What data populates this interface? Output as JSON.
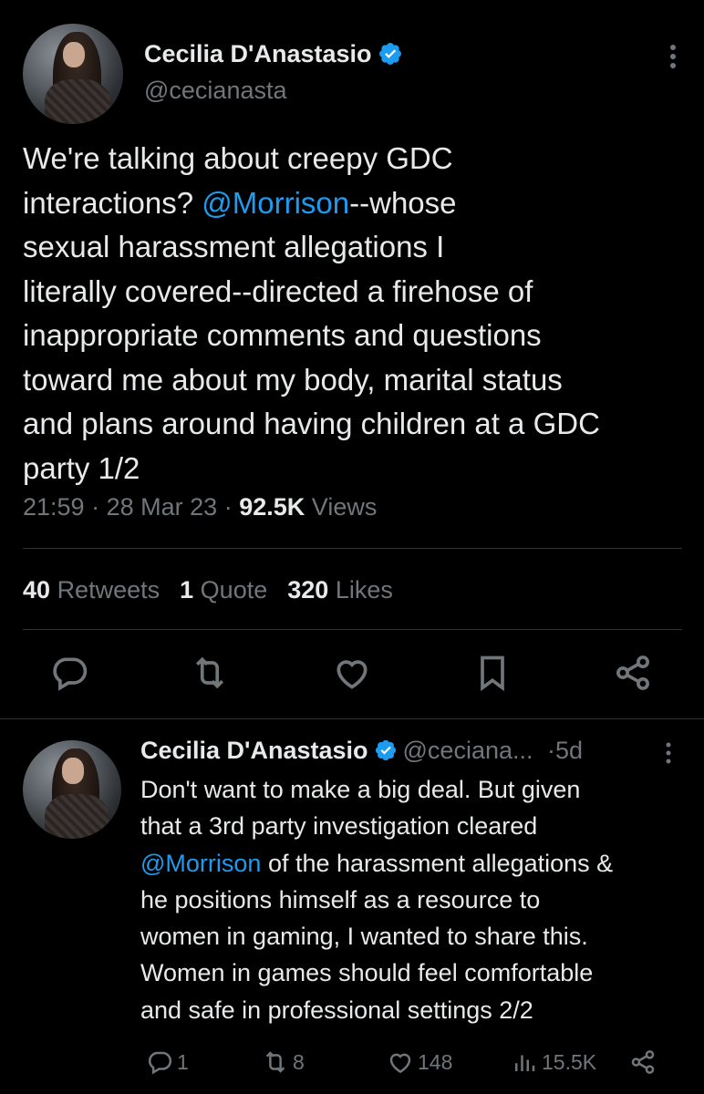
{
  "main_tweet": {
    "author_name": "Cecilia D'Anastasio",
    "author_handle": "@cecianasta",
    "text_part1": "We're talking about creepy GDC\ninteractions? ",
    "mention": "@Morrison",
    "text_part2": "--whose\nsexual harassment allegations I\nliterally covered--directed a firehose of\ninappropriate comments and questions\ntoward me about my body, marital status\nand plans around having children at a GDC\nparty 1/2",
    "time": "21:59",
    "date": "28 Mar 23",
    "views_count": "92.5K",
    "views_label": "Views",
    "separator": "·",
    "retweets_count": "40",
    "retweets_label": "Retweets",
    "quotes_count": "1",
    "quotes_label": "Quote",
    "likes_count": "320",
    "likes_label": "Likes",
    "icons": [
      "more-icon",
      "reply-icon",
      "retweet-icon",
      "like-icon",
      "bookmark-icon",
      "share-icon"
    ]
  },
  "reply_tweet": {
    "author_name": "Cecilia D'Anastasio",
    "author_handle": "@ceciana...",
    "age": "5d",
    "separator": "·",
    "text_part1": "Don't want to make a big deal. But given\nthat a 3rd party investigation cleared\n",
    "mention": "@Morrison",
    "text_part2": " of the harassment allegations &\nhe positions himself as a resource to\nwomen in gaming, I wanted to share this.\nWomen in games should feel comfortable\nand safe in professional settings 2/2",
    "reply_count": "1",
    "retweet_count": "8",
    "like_count": "148",
    "views_count": "15.5K"
  },
  "colors": {
    "background": "#000000",
    "text": "#e7e9ea",
    "secondary": "#71767b",
    "accent": "#1d9bf0",
    "divider": "#2f3336"
  }
}
